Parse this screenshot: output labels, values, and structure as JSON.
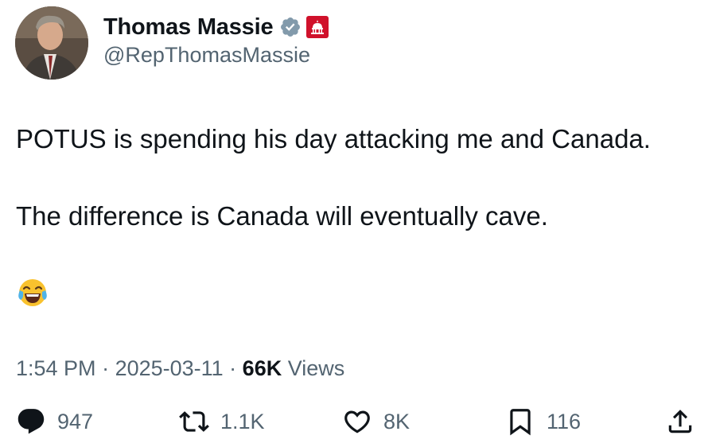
{
  "author": {
    "name": "Thomas Massie",
    "handle": "@RepThomasMassie",
    "verified_color": "#829aab",
    "gov_badge_color": "#d0112b"
  },
  "tweet": {
    "line1": "POTUS is spending his day attacking me and Canada.",
    "line2": "The difference is Canada will eventually cave.",
    "emoji": "face-with-tears-of-joy"
  },
  "meta": {
    "time": "1:54 PM",
    "sep1": " · ",
    "date": "2025-03-11",
    "sep2": " · ",
    "views_count": "66K",
    "views_label": " Views"
  },
  "actions": {
    "replies": "947",
    "reposts": "1.1K",
    "likes": "8K",
    "bookmarks": "116"
  },
  "icons": [
    "reply-icon",
    "repost-icon",
    "like-icon",
    "bookmark-icon",
    "share-icon"
  ]
}
